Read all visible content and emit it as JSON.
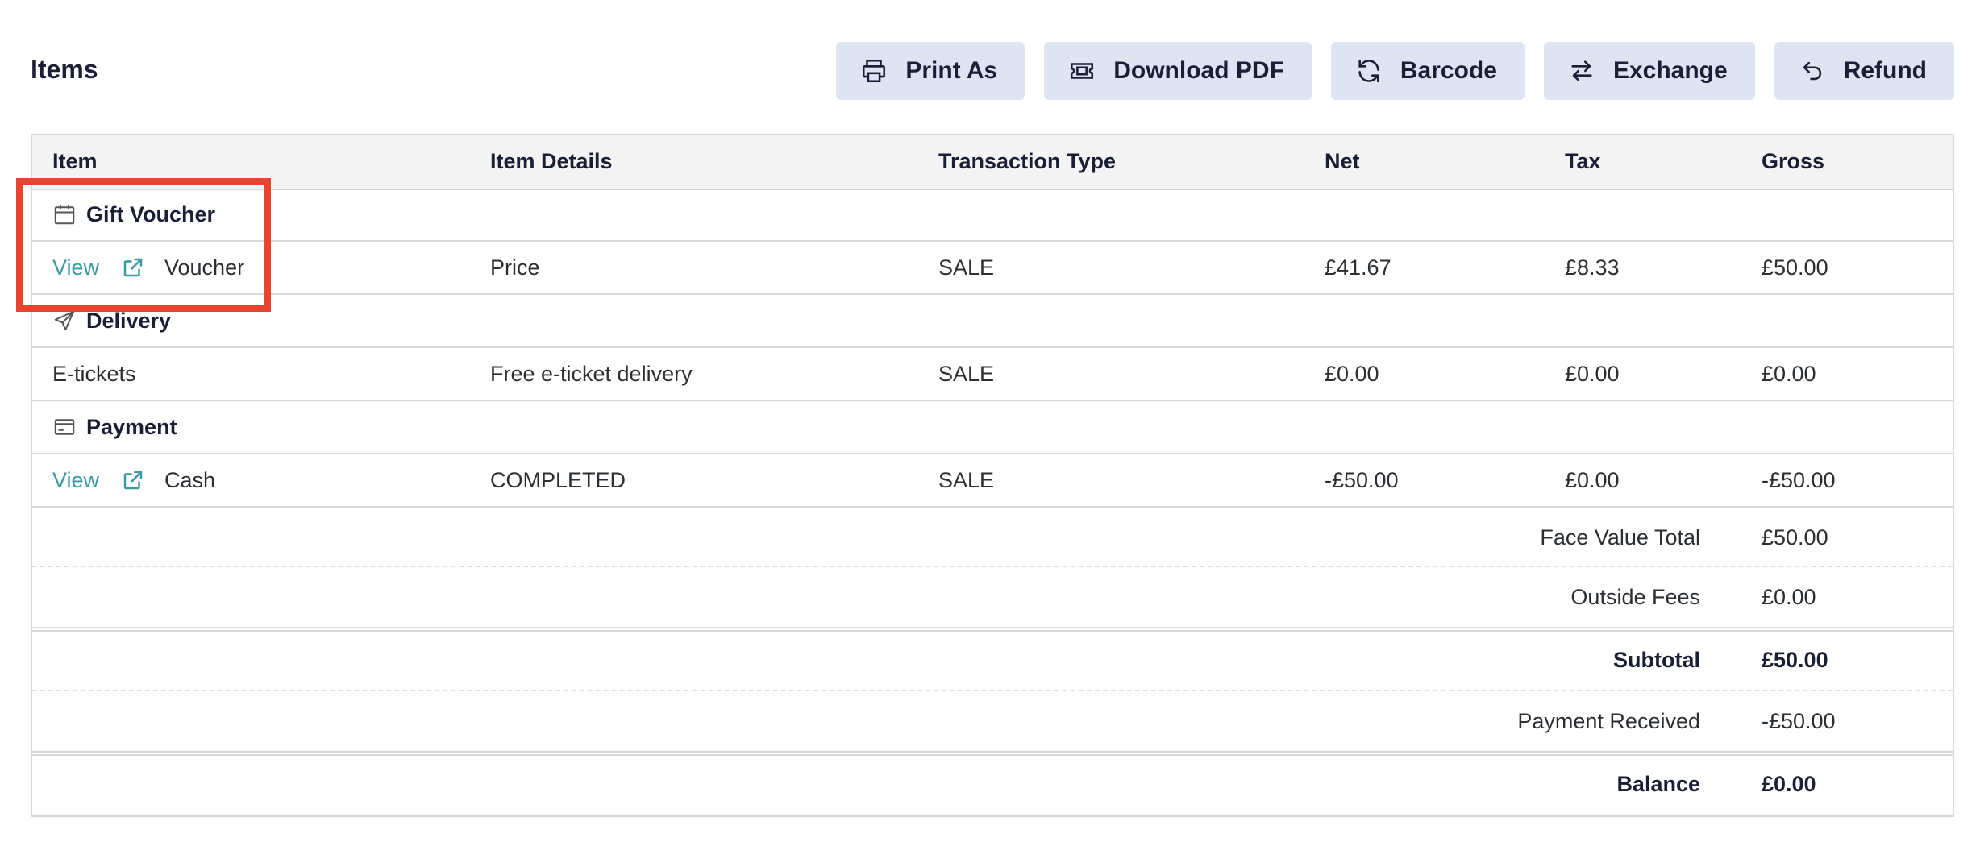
{
  "title": "Items",
  "toolbar": {
    "print": "Print As",
    "download": "Download PDF",
    "barcode": "Barcode",
    "exchange": "Exchange",
    "refund": "Refund"
  },
  "columns": [
    "Item",
    "Item Details",
    "Transaction Type",
    "Net",
    "Tax",
    "Gross"
  ],
  "groups": {
    "gift": {
      "label": "Gift Voucher",
      "row": {
        "link": "View",
        "item": "Voucher",
        "details": "Price",
        "type": "SALE",
        "net": "£41.67",
        "tax": "£8.33",
        "gross": "£50.00"
      }
    },
    "delivery": {
      "label": "Delivery",
      "row": {
        "item": "E-tickets",
        "details": "Free e-ticket delivery",
        "type": "SALE",
        "net": "£0.00",
        "tax": "£0.00",
        "gross": "£0.00"
      }
    },
    "payment": {
      "label": "Payment",
      "row": {
        "link": "View",
        "item": "Cash",
        "details": "COMPLETED",
        "type": "SALE",
        "net": "-£50.00",
        "tax": "£0.00",
        "gross": "-£50.00"
      }
    }
  },
  "summary": {
    "face_value_label": "Face Value Total",
    "face_value": "£50.00",
    "outside_fees_label": "Outside Fees",
    "outside_fees": "£0.00",
    "subtotal_label": "Subtotal",
    "subtotal": "£50.00",
    "payment_received_label": "Payment Received",
    "payment_received": "-£50.00",
    "balance_label": "Balance",
    "balance": "£0.00"
  },
  "colors": {
    "accent_link": "#3a9aa0",
    "button_bg": "#dfe4f3",
    "highlight": "#e8442f"
  }
}
